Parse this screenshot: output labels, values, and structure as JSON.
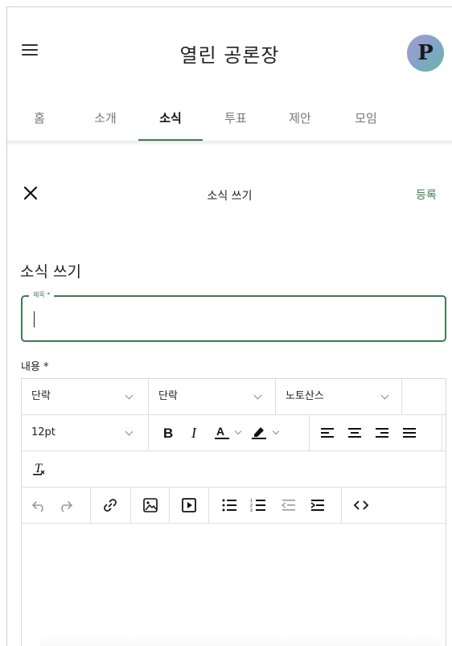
{
  "header": {
    "title": "열린 공론장",
    "avatar_letter": "P"
  },
  "tabs": [
    {
      "label": "홈",
      "active": false
    },
    {
      "label": "소개",
      "active": false
    },
    {
      "label": "소식",
      "active": true
    },
    {
      "label": "투표",
      "active": false
    },
    {
      "label": "제안",
      "active": false
    },
    {
      "label": "모임",
      "active": false
    }
  ],
  "editor_header": {
    "title": "소식 쓰기",
    "submit_label": "등록"
  },
  "form": {
    "heading": "소식 쓰기",
    "title_field_label": "제목 *",
    "title_value": "",
    "content_label": "내용 *"
  },
  "toolbar": {
    "block_format": "단락",
    "block_format_2": "단락",
    "font_family": "노토산스",
    "font_size": "12pt"
  },
  "colors": {
    "accent": "#3d7a52"
  }
}
